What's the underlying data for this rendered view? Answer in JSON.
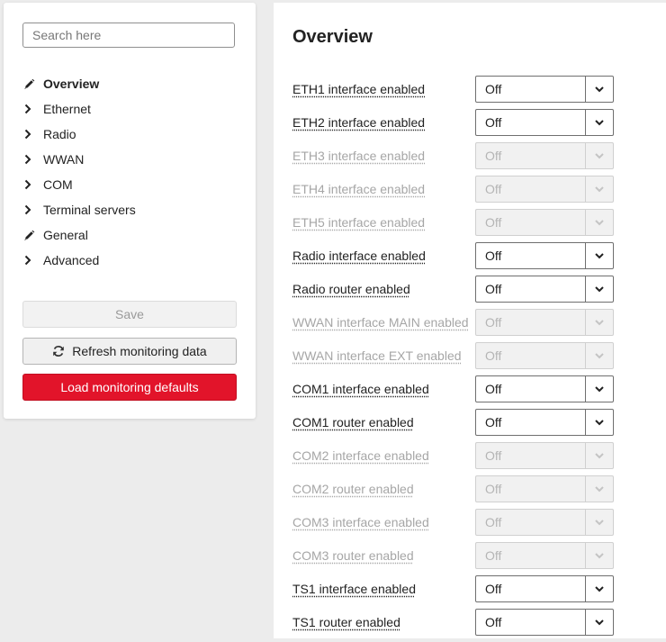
{
  "sidebar": {
    "search_placeholder": "Search here",
    "items": [
      {
        "label": "Overview",
        "icon": "pencil-icon",
        "active": true
      },
      {
        "label": "Ethernet",
        "icon": "chevron-right-icon"
      },
      {
        "label": "Radio",
        "icon": "chevron-right-icon"
      },
      {
        "label": "WWAN",
        "icon": "chevron-right-icon"
      },
      {
        "label": "COM",
        "icon": "chevron-right-icon"
      },
      {
        "label": "Terminal servers",
        "icon": "chevron-right-icon"
      },
      {
        "label": "General",
        "icon": "pencil-icon"
      },
      {
        "label": "Advanced",
        "icon": "chevron-right-icon"
      }
    ],
    "save_label": "Save",
    "refresh_label": "Refresh monitoring data",
    "load_defaults_label": "Load monitoring defaults"
  },
  "main": {
    "title": "Overview",
    "rows": [
      {
        "label": "ETH1 interface enabled",
        "value": "Off",
        "enabled": true
      },
      {
        "label": "ETH2 interface enabled",
        "value": "Off",
        "enabled": true
      },
      {
        "label": "ETH3 interface enabled",
        "value": "Off",
        "enabled": false
      },
      {
        "label": "ETH4 interface enabled",
        "value": "Off",
        "enabled": false
      },
      {
        "label": "ETH5 interface enabled",
        "value": "Off",
        "enabled": false
      },
      {
        "label": "Radio interface enabled",
        "value": "Off",
        "enabled": true
      },
      {
        "label": "Radio router enabled",
        "value": "Off",
        "enabled": true
      },
      {
        "label": "WWAN interface MAIN enabled",
        "value": "Off",
        "enabled": false
      },
      {
        "label": "WWAN interface EXT enabled",
        "value": "Off",
        "enabled": false
      },
      {
        "label": "COM1 interface enabled",
        "value": "Off",
        "enabled": true
      },
      {
        "label": "COM1 router enabled",
        "value": "Off",
        "enabled": true
      },
      {
        "label": "COM2 interface enabled",
        "value": "Off",
        "enabled": false
      },
      {
        "label": "COM2 router enabled",
        "value": "Off",
        "enabled": false
      },
      {
        "label": "COM3 interface enabled",
        "value": "Off",
        "enabled": false
      },
      {
        "label": "COM3 router enabled",
        "value": "Off",
        "enabled": false
      },
      {
        "label": "TS1 interface enabled",
        "value": "Off",
        "enabled": true
      },
      {
        "label": "TS1 router enabled",
        "value": "Off",
        "enabled": true
      }
    ]
  },
  "colors": {
    "accent_red": "#e2142a",
    "disabled_text": "#a6a6a6",
    "background": "#ececec"
  }
}
